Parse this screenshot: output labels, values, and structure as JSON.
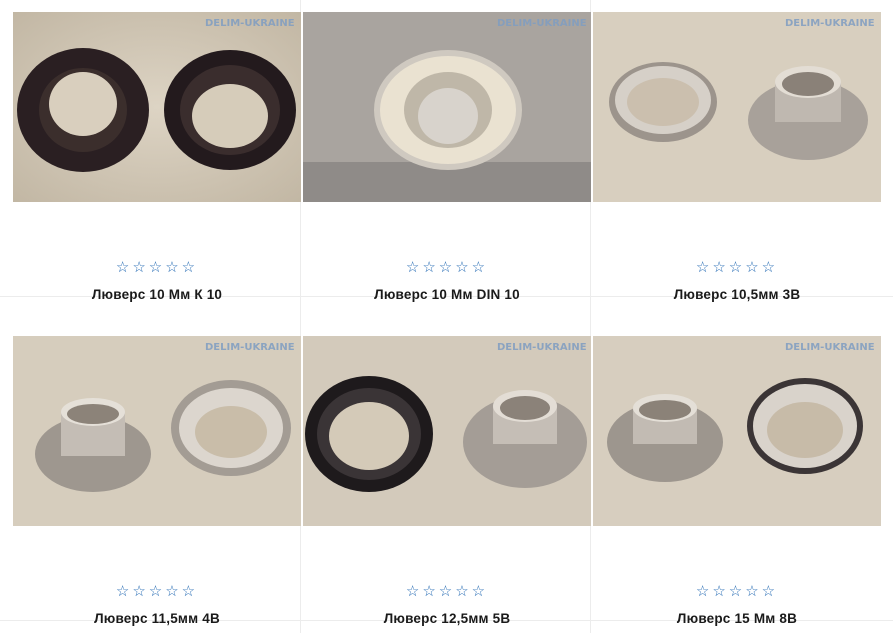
{
  "watermark": "DELIM-UKRAINE",
  "rating_stars": "☆☆☆☆☆",
  "colors": {
    "star": "#2b6fb6",
    "title": "#1a1a1a",
    "divider": "#ececec"
  },
  "products": [
    {
      "title": "Люверс 10 Мм К 10",
      "image": "black-eyelet-pair-icon"
    },
    {
      "title": "Люверс 10 Мм DIN 10",
      "image": "eyelet-in-fabric-icon"
    },
    {
      "title": "Люверс 10,5мм 3В",
      "image": "nickel-eyelet-pair-icon"
    },
    {
      "title": "Люверс 11,5мм 4В",
      "image": "nickel-eyelet-pair-icon"
    },
    {
      "title": "Люверс 12,5мм 5В",
      "image": "black-and-nickel-eyelet-icon"
    },
    {
      "title": "Люверс 15 Мм 8В",
      "image": "nickel-eyelet-pair-icon"
    }
  ]
}
